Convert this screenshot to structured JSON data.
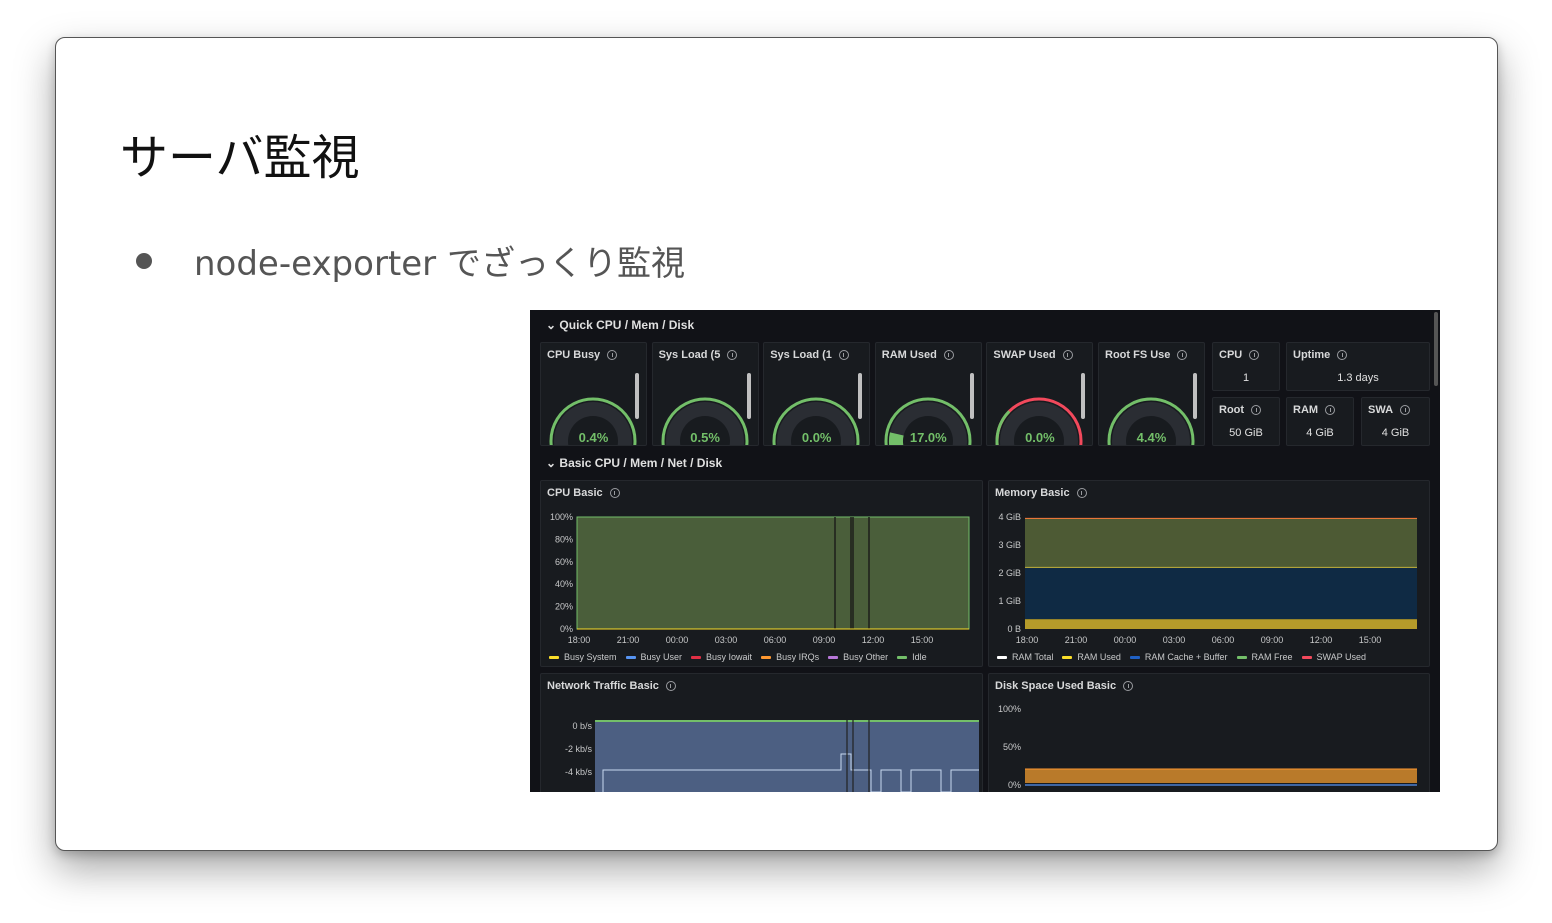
{
  "slide": {
    "title": "サーバ監視",
    "bullet": "node-exporter でざっくり監視"
  },
  "dashboard": {
    "rows": [
      "Quick CPU / Mem / Disk",
      "Basic CPU / Mem / Net / Disk"
    ],
    "gauges": [
      {
        "title": "CPU Busy",
        "value": "0.4%",
        "fraction": 0.004
      },
      {
        "title": "Sys Load (5",
        "value": "0.5%",
        "fraction": 0.005
      },
      {
        "title": "Sys Load (1",
        "value": "0.0%",
        "fraction": 0.0
      },
      {
        "title": "RAM Used",
        "value": "17.0%",
        "fraction": 0.17
      },
      {
        "title": "SWAP Used",
        "value": "0.0%",
        "fraction": 0.0
      },
      {
        "title": "Root FS Use",
        "value": "4.4%",
        "fraction": 0.044
      }
    ],
    "stats": [
      {
        "title": "CPU",
        "value": "1"
      },
      {
        "title": "Uptime",
        "value": "1.3 days"
      },
      {
        "title": "Root",
        "value": "50 GiB"
      },
      {
        "title": "RAM",
        "value": "4 GiB"
      },
      {
        "title": "SWA",
        "value": "4 GiB"
      }
    ],
    "colors": {
      "green": "#73bf69",
      "yellow": "#fade2a",
      "red": "#f2495c",
      "blue": "#5794f2",
      "orange": "#ff9830",
      "purple": "#b877d9"
    }
  },
  "chart_data": [
    {
      "type": "area",
      "title": "CPU Basic",
      "y_ticks": [
        "100%",
        "80%",
        "60%",
        "40%",
        "20%",
        "0%"
      ],
      "x_ticks": [
        "18:00",
        "21:00",
        "00:00",
        "03:00",
        "06:00",
        "09:00",
        "12:00",
        "15:00"
      ],
      "series": [
        {
          "name": "Busy System",
          "color": "#fade2a"
        },
        {
          "name": "Busy User",
          "color": "#5794f2"
        },
        {
          "name": "Busy Iowait",
          "color": "#e02f44"
        },
        {
          "name": "Busy IRQs",
          "color": "#ff9830"
        },
        {
          "name": "Busy Other",
          "color": "#b877d9"
        },
        {
          "name": "Idle",
          "color": "#73bf69",
          "level": 1.0
        }
      ]
    },
    {
      "type": "area",
      "title": "Memory Basic",
      "y_ticks": [
        "4 GiB",
        "3 GiB",
        "2 GiB",
        "1 GiB",
        "0 B"
      ],
      "x_ticks": [
        "18:00",
        "21:00",
        "00:00",
        "03:00",
        "06:00",
        "09:00",
        "12:00",
        "15:00"
      ],
      "series": [
        {
          "name": "RAM Total",
          "color": "#ffffff"
        },
        {
          "name": "RAM Used",
          "color": "#fade2a"
        },
        {
          "name": "RAM Cache + Buffer",
          "color": "#1f60c4"
        },
        {
          "name": "RAM Free",
          "color": "#73bf69"
        },
        {
          "name": "SWAP Used",
          "color": "#f2495c"
        }
      ]
    },
    {
      "type": "area",
      "title": "Network Traffic Basic",
      "y_ticks": [
        "0 b/s",
        "-2 kb/s",
        "-4 kb/s"
      ]
    },
    {
      "type": "area",
      "title": "Disk Space Used Basic",
      "y_ticks": [
        "100%",
        "50%",
        "0%"
      ]
    }
  ]
}
